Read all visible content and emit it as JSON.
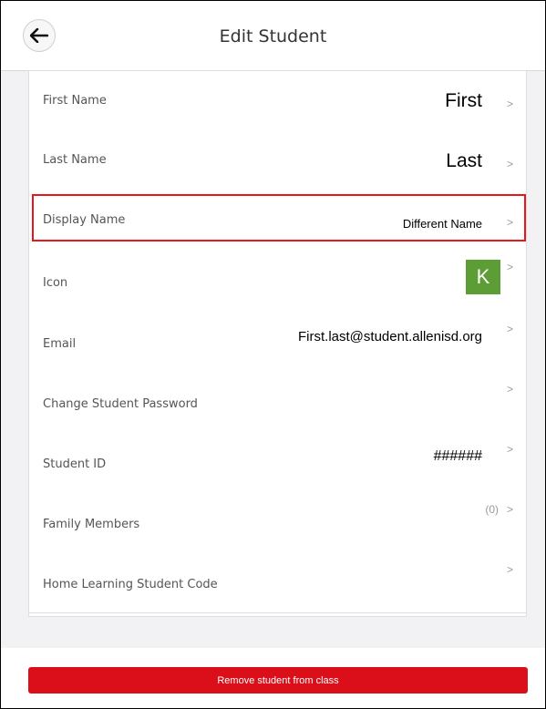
{
  "header": {
    "title": "Edit Student",
    "back_icon": "arrow-left-icon"
  },
  "rows": {
    "first_name": {
      "label": "First Name",
      "value": "First",
      "chevron": ">"
    },
    "last_name": {
      "label": "Last Name",
      "value": "Last",
      "chevron": ">"
    },
    "display_name": {
      "label": "Display Name",
      "value": "Different Name",
      "chevron": ">"
    },
    "icon": {
      "label": "Icon",
      "avatar_letter": "K",
      "avatar_color": "#5c9e35",
      "chevron": ">"
    },
    "email": {
      "label": "Email",
      "value": "First.last@student.allenisd.org",
      "chevron": ">"
    },
    "change_password": {
      "label": "Change Student Password",
      "chevron": ">"
    },
    "student_id": {
      "label": "Student ID",
      "value": "######",
      "chevron": ">"
    },
    "family_members": {
      "label": "Family Members",
      "count": "(0)",
      "chevron": ">"
    },
    "home_learning_code": {
      "label": "Home Learning Student Code",
      "chevron": ">"
    }
  },
  "footer": {
    "remove_label": "Remove student from class"
  },
  "colors": {
    "highlight": "#e8151c",
    "remove_button": "#da0f1a"
  }
}
